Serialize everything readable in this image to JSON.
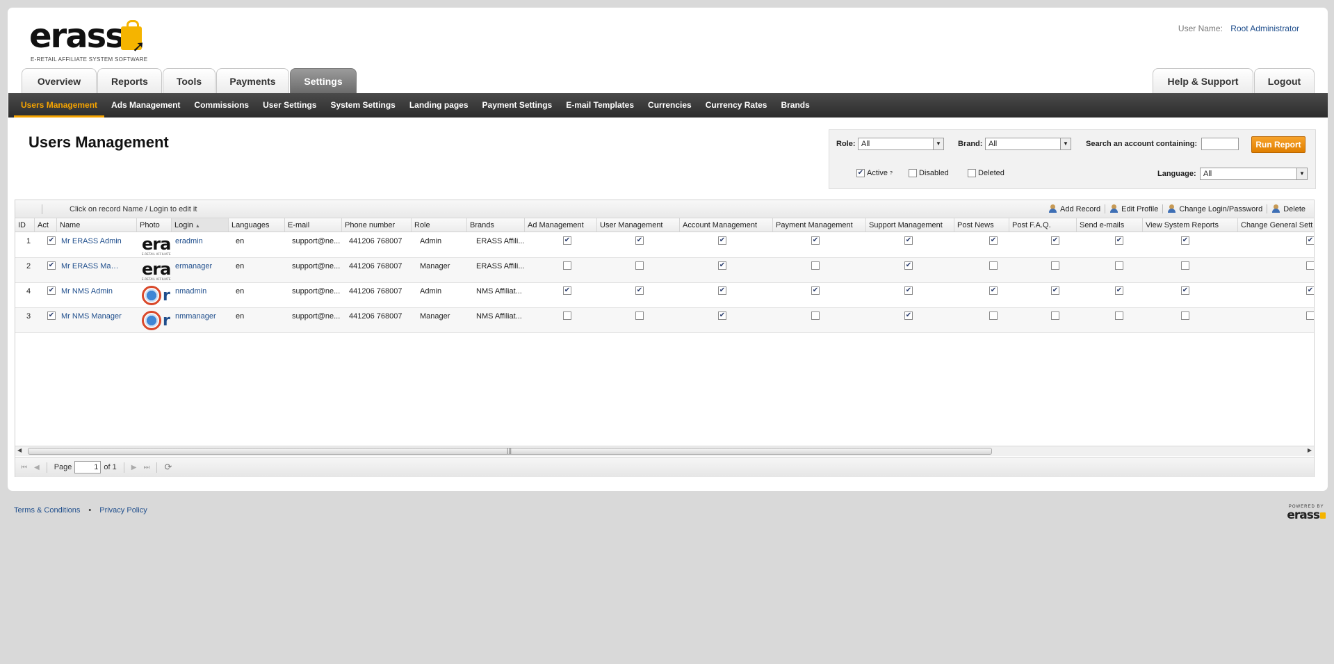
{
  "logo": {
    "word": "erass",
    "tagline": "E-RETAIL AFFILIATE SYSTEM SOFTWARE"
  },
  "user": {
    "label": "User Name:",
    "name": "Root Administrator"
  },
  "main_tabs": [
    "Overview",
    "Reports",
    "Tools",
    "Payments",
    "Settings"
  ],
  "right_tabs": [
    "Help & Support",
    "Logout"
  ],
  "subnav": [
    "Users Management",
    "Ads Management",
    "Commissions",
    "User Settings",
    "System Settings",
    "Landing pages",
    "Payment Settings",
    "E-mail Templates",
    "Currencies",
    "Currency Rates",
    "Brands"
  ],
  "page_title": "Users Management",
  "filter": {
    "role_label": "Role:",
    "role_value": "All",
    "brand_label": "Brand:",
    "brand_value": "All",
    "search_label": "Search an account containing:",
    "run_label": "Run Report",
    "active_label": "Active",
    "active_sup": "?",
    "disabled_label": "Disabled",
    "deleted_label": "Deleted",
    "language_label": "Language:",
    "language_value": "All",
    "active_checked": true,
    "disabled_checked": false,
    "deleted_checked": false
  },
  "toolbar": {
    "hint": "Click on record Name / Login to edit it",
    "actions": [
      "Add Record",
      "Edit Profile",
      "Change Login/Password",
      "Delete"
    ]
  },
  "columns": [
    "ID",
    "Act",
    "Name",
    "Photo",
    "Login",
    "Languages",
    "E-mail",
    "Phone number",
    "Role",
    "Brands",
    "Ad Management",
    "User Management",
    "Account Management",
    "Payment Management",
    "Support Management",
    "Post News",
    "Post F.A.Q.",
    "Send e-mails",
    "View System Reports",
    "Change General Sett"
  ],
  "rows": [
    {
      "id": "1",
      "name": "Mr ERASS Admin",
      "photo": "erass",
      "login": "eradmin",
      "languages": "en",
      "email": "support@ne...",
      "phone": "441206 768007",
      "role": "Admin",
      "brands": "ERASS Affili...",
      "perms": [
        true,
        true,
        true,
        true,
        true,
        true,
        true,
        true,
        true,
        true
      ]
    },
    {
      "id": "2",
      "name": "Mr ERASS Mana...",
      "photo": "erass",
      "login": "ermanager",
      "languages": "en",
      "email": "support@ne...",
      "phone": "441206 768007",
      "role": "Manager",
      "brands": "ERASS Affili...",
      "perms": [
        false,
        false,
        true,
        false,
        true,
        false,
        false,
        false,
        false,
        false
      ]
    },
    {
      "id": "4",
      "name": "Mr NMS Admin",
      "photo": "nms",
      "login": "nmadmin",
      "languages": "en",
      "email": "support@ne...",
      "phone": "441206 768007",
      "role": "Admin",
      "brands": "NMS Affiliat...",
      "perms": [
        true,
        true,
        true,
        true,
        true,
        true,
        true,
        true,
        true,
        true
      ]
    },
    {
      "id": "3",
      "name": "Mr NMS Manager",
      "photo": "nms",
      "login": "nmmanager",
      "languages": "en",
      "email": "support@ne...",
      "phone": "441206 768007",
      "role": "Manager",
      "brands": "NMS Affiliat...",
      "perms": [
        false,
        false,
        true,
        false,
        true,
        false,
        false,
        false,
        false,
        false
      ]
    }
  ],
  "pager": {
    "page_label": "Page",
    "page_value": "1",
    "of_label": "of 1"
  },
  "footer": {
    "terms": "Terms & Conditions",
    "separator": "•",
    "privacy": "Privacy Policy",
    "powered_by": "POWERED BY",
    "powered_brand": "erass"
  },
  "colors": {
    "accent": "#f5a300",
    "link": "#1f4e8c",
    "nav_bg": "#333333"
  }
}
